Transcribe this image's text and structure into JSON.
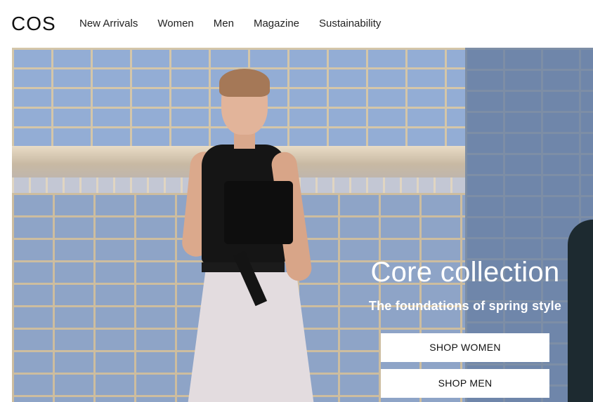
{
  "brand": {
    "logo": "COS"
  },
  "nav": {
    "items": [
      {
        "label": "New Arrivals"
      },
      {
        "label": "Women"
      },
      {
        "label": "Men"
      },
      {
        "label": "Magazine"
      },
      {
        "label": "Sustainability"
      }
    ]
  },
  "hero": {
    "title": "Core collection",
    "subtitle": "The foundations of spring style",
    "buttons": {
      "women": "SHOP WOMEN",
      "men": "SHOP MEN"
    }
  },
  "colors": {
    "text": "#111111",
    "background": "#ffffff",
    "button_bg": "#ffffff",
    "hero_text": "#ffffff"
  }
}
